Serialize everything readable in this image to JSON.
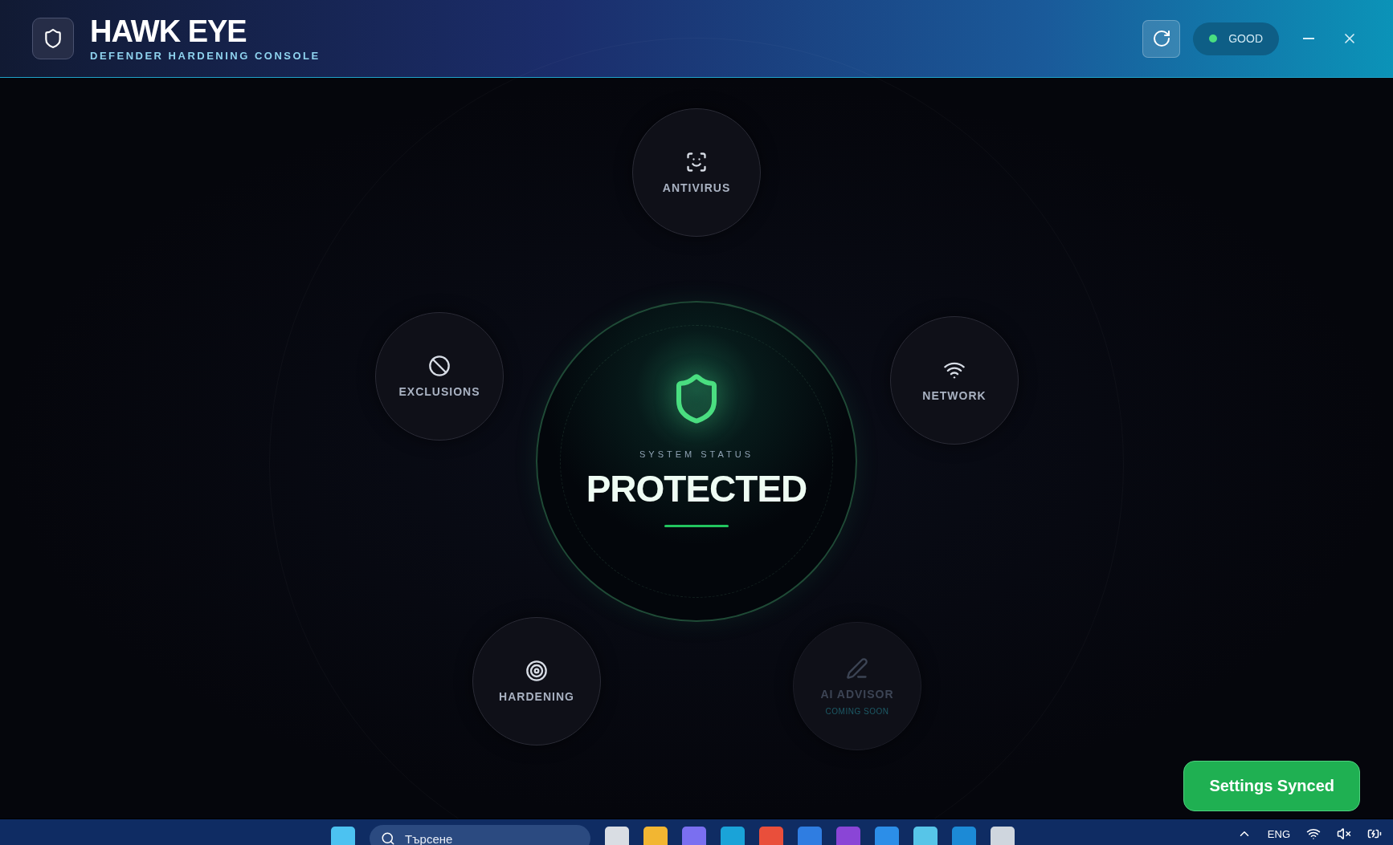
{
  "header": {
    "title": "HAWK EYE",
    "subtitle": "DEFENDER HARDENING CONSOLE",
    "status": {
      "label": "GOOD",
      "color": "#4ade80"
    }
  },
  "center": {
    "caption": "SYSTEM STATUS",
    "status": "PROTECTED"
  },
  "nodes": [
    {
      "kind": "antivirus",
      "label": "ANTIVIRUS",
      "disabled": false
    },
    {
      "kind": "exclusions",
      "label": "EXCLUSIONS",
      "disabled": false
    },
    {
      "kind": "network",
      "label": "NETWORK",
      "disabled": false
    },
    {
      "kind": "hardening",
      "label": "HARDENING",
      "disabled": false
    },
    {
      "kind": "advisor",
      "label": "AI ADVISOR",
      "disabled": true,
      "note": "COMING SOON"
    }
  ],
  "toast": "Settings Synced",
  "taskbar": {
    "search_placeholder": "Търсене",
    "language": "ENG"
  }
}
